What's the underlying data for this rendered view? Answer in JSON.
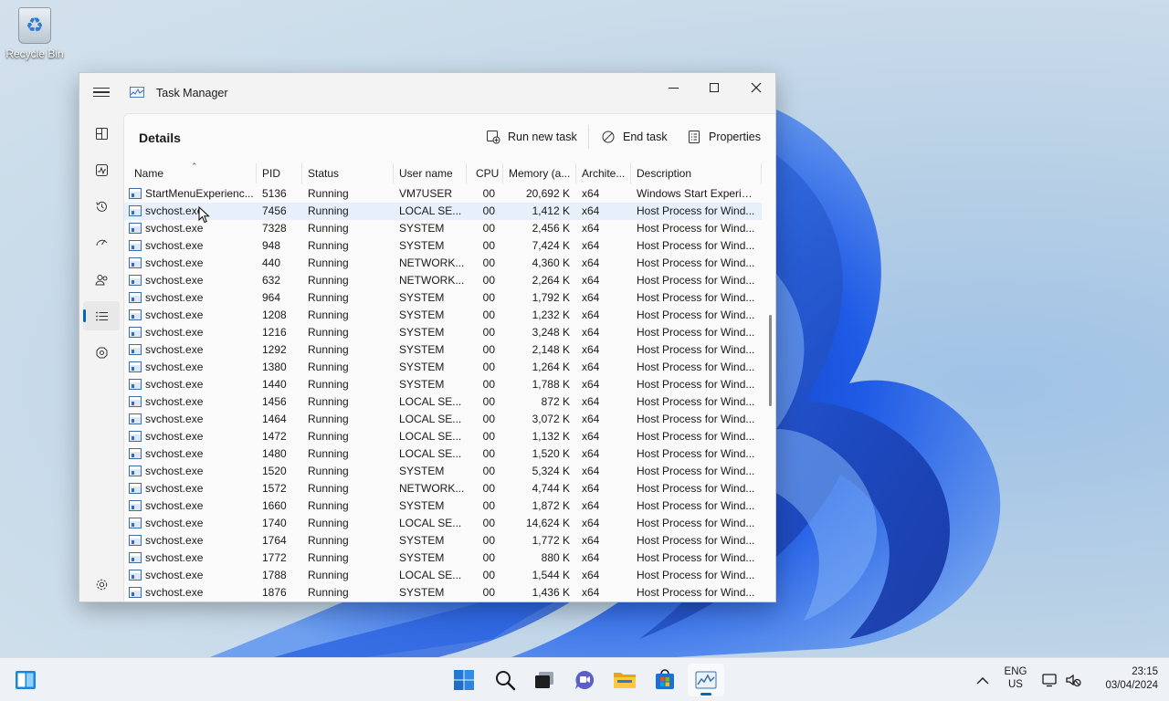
{
  "desktop": {
    "recycle_bin_label": "Recycle Bin"
  },
  "window": {
    "title": "Task Manager",
    "page_title": "Details",
    "toolbar": {
      "run_new_task": "Run new task",
      "end_task": "End task",
      "properties": "Properties"
    }
  },
  "nav_items": [
    "hamburger-menu",
    "processes-icon",
    "performance-icon",
    "app-history-icon",
    "startup-apps-icon",
    "users-icon",
    "details-icon",
    "services-icon",
    "settings-icon"
  ],
  "columns": [
    "Name",
    "PID",
    "Status",
    "User name",
    "CPU",
    "Memory (a...",
    "Archite...",
    "Description"
  ],
  "rows": [
    [
      "StartMenuExperienc...",
      "5136",
      "Running",
      "VM7USER",
      "00",
      "20,692 K",
      "x64",
      "Windows Start Experie..."
    ],
    [
      "svchost.exe",
      "7456",
      "Running",
      "LOCAL SE...",
      "00",
      "1,412 K",
      "x64",
      "Host Process for Wind..."
    ],
    [
      "svchost.exe",
      "7328",
      "Running",
      "SYSTEM",
      "00",
      "2,456 K",
      "x64",
      "Host Process for Wind..."
    ],
    [
      "svchost.exe",
      "948",
      "Running",
      "SYSTEM",
      "00",
      "7,424 K",
      "x64",
      "Host Process for Wind..."
    ],
    [
      "svchost.exe",
      "440",
      "Running",
      "NETWORK...",
      "00",
      "4,360 K",
      "x64",
      "Host Process for Wind..."
    ],
    [
      "svchost.exe",
      "632",
      "Running",
      "NETWORK...",
      "00",
      "2,264 K",
      "x64",
      "Host Process for Wind..."
    ],
    [
      "svchost.exe",
      "964",
      "Running",
      "SYSTEM",
      "00",
      "1,792 K",
      "x64",
      "Host Process for Wind..."
    ],
    [
      "svchost.exe",
      "1208",
      "Running",
      "SYSTEM",
      "00",
      "1,232 K",
      "x64",
      "Host Process for Wind..."
    ],
    [
      "svchost.exe",
      "1216",
      "Running",
      "SYSTEM",
      "00",
      "3,248 K",
      "x64",
      "Host Process for Wind..."
    ],
    [
      "svchost.exe",
      "1292",
      "Running",
      "SYSTEM",
      "00",
      "2,148 K",
      "x64",
      "Host Process for Wind..."
    ],
    [
      "svchost.exe",
      "1380",
      "Running",
      "SYSTEM",
      "00",
      "1,264 K",
      "x64",
      "Host Process for Wind..."
    ],
    [
      "svchost.exe",
      "1440",
      "Running",
      "SYSTEM",
      "00",
      "1,788 K",
      "x64",
      "Host Process for Wind..."
    ],
    [
      "svchost.exe",
      "1456",
      "Running",
      "LOCAL SE...",
      "00",
      "872 K",
      "x64",
      "Host Process for Wind..."
    ],
    [
      "svchost.exe",
      "1464",
      "Running",
      "LOCAL SE...",
      "00",
      "3,072 K",
      "x64",
      "Host Process for Wind..."
    ],
    [
      "svchost.exe",
      "1472",
      "Running",
      "LOCAL SE...",
      "00",
      "1,132 K",
      "x64",
      "Host Process for Wind..."
    ],
    [
      "svchost.exe",
      "1480",
      "Running",
      "LOCAL SE...",
      "00",
      "1,520 K",
      "x64",
      "Host Process for Wind..."
    ],
    [
      "svchost.exe",
      "1520",
      "Running",
      "SYSTEM",
      "00",
      "5,324 K",
      "x64",
      "Host Process for Wind..."
    ],
    [
      "svchost.exe",
      "1572",
      "Running",
      "NETWORK...",
      "00",
      "4,744 K",
      "x64",
      "Host Process for Wind..."
    ],
    [
      "svchost.exe",
      "1660",
      "Running",
      "SYSTEM",
      "00",
      "1,872 K",
      "x64",
      "Host Process for Wind..."
    ],
    [
      "svchost.exe",
      "1740",
      "Running",
      "LOCAL SE...",
      "00",
      "14,624 K",
      "x64",
      "Host Process for Wind..."
    ],
    [
      "svchost.exe",
      "1764",
      "Running",
      "SYSTEM",
      "00",
      "1,772 K",
      "x64",
      "Host Process for Wind..."
    ],
    [
      "svchost.exe",
      "1772",
      "Running",
      "SYSTEM",
      "00",
      "880 K",
      "x64",
      "Host Process for Wind..."
    ],
    [
      "svchost.exe",
      "1788",
      "Running",
      "LOCAL SE...",
      "00",
      "1,544 K",
      "x64",
      "Host Process for Wind..."
    ],
    [
      "svchost.exe",
      "1876",
      "Running",
      "SYSTEM",
      "00",
      "1,436 K",
      "x64",
      "Host Process for Wind..."
    ]
  ],
  "highlighted_row": 1,
  "taskbar": {
    "language": "ENG",
    "region": "US",
    "time": "23:15",
    "date": "03/04/2024",
    "apps": [
      "widgets-icon",
      "start-icon",
      "search-icon",
      "task-view-icon",
      "chat-icon",
      "file-explorer-icon",
      "store-icon",
      "task-manager-icon"
    ]
  },
  "colors": {
    "accent": "#0067c0",
    "wallpaper_blue": "#1a4fd6",
    "selection": "#e6effa"
  }
}
